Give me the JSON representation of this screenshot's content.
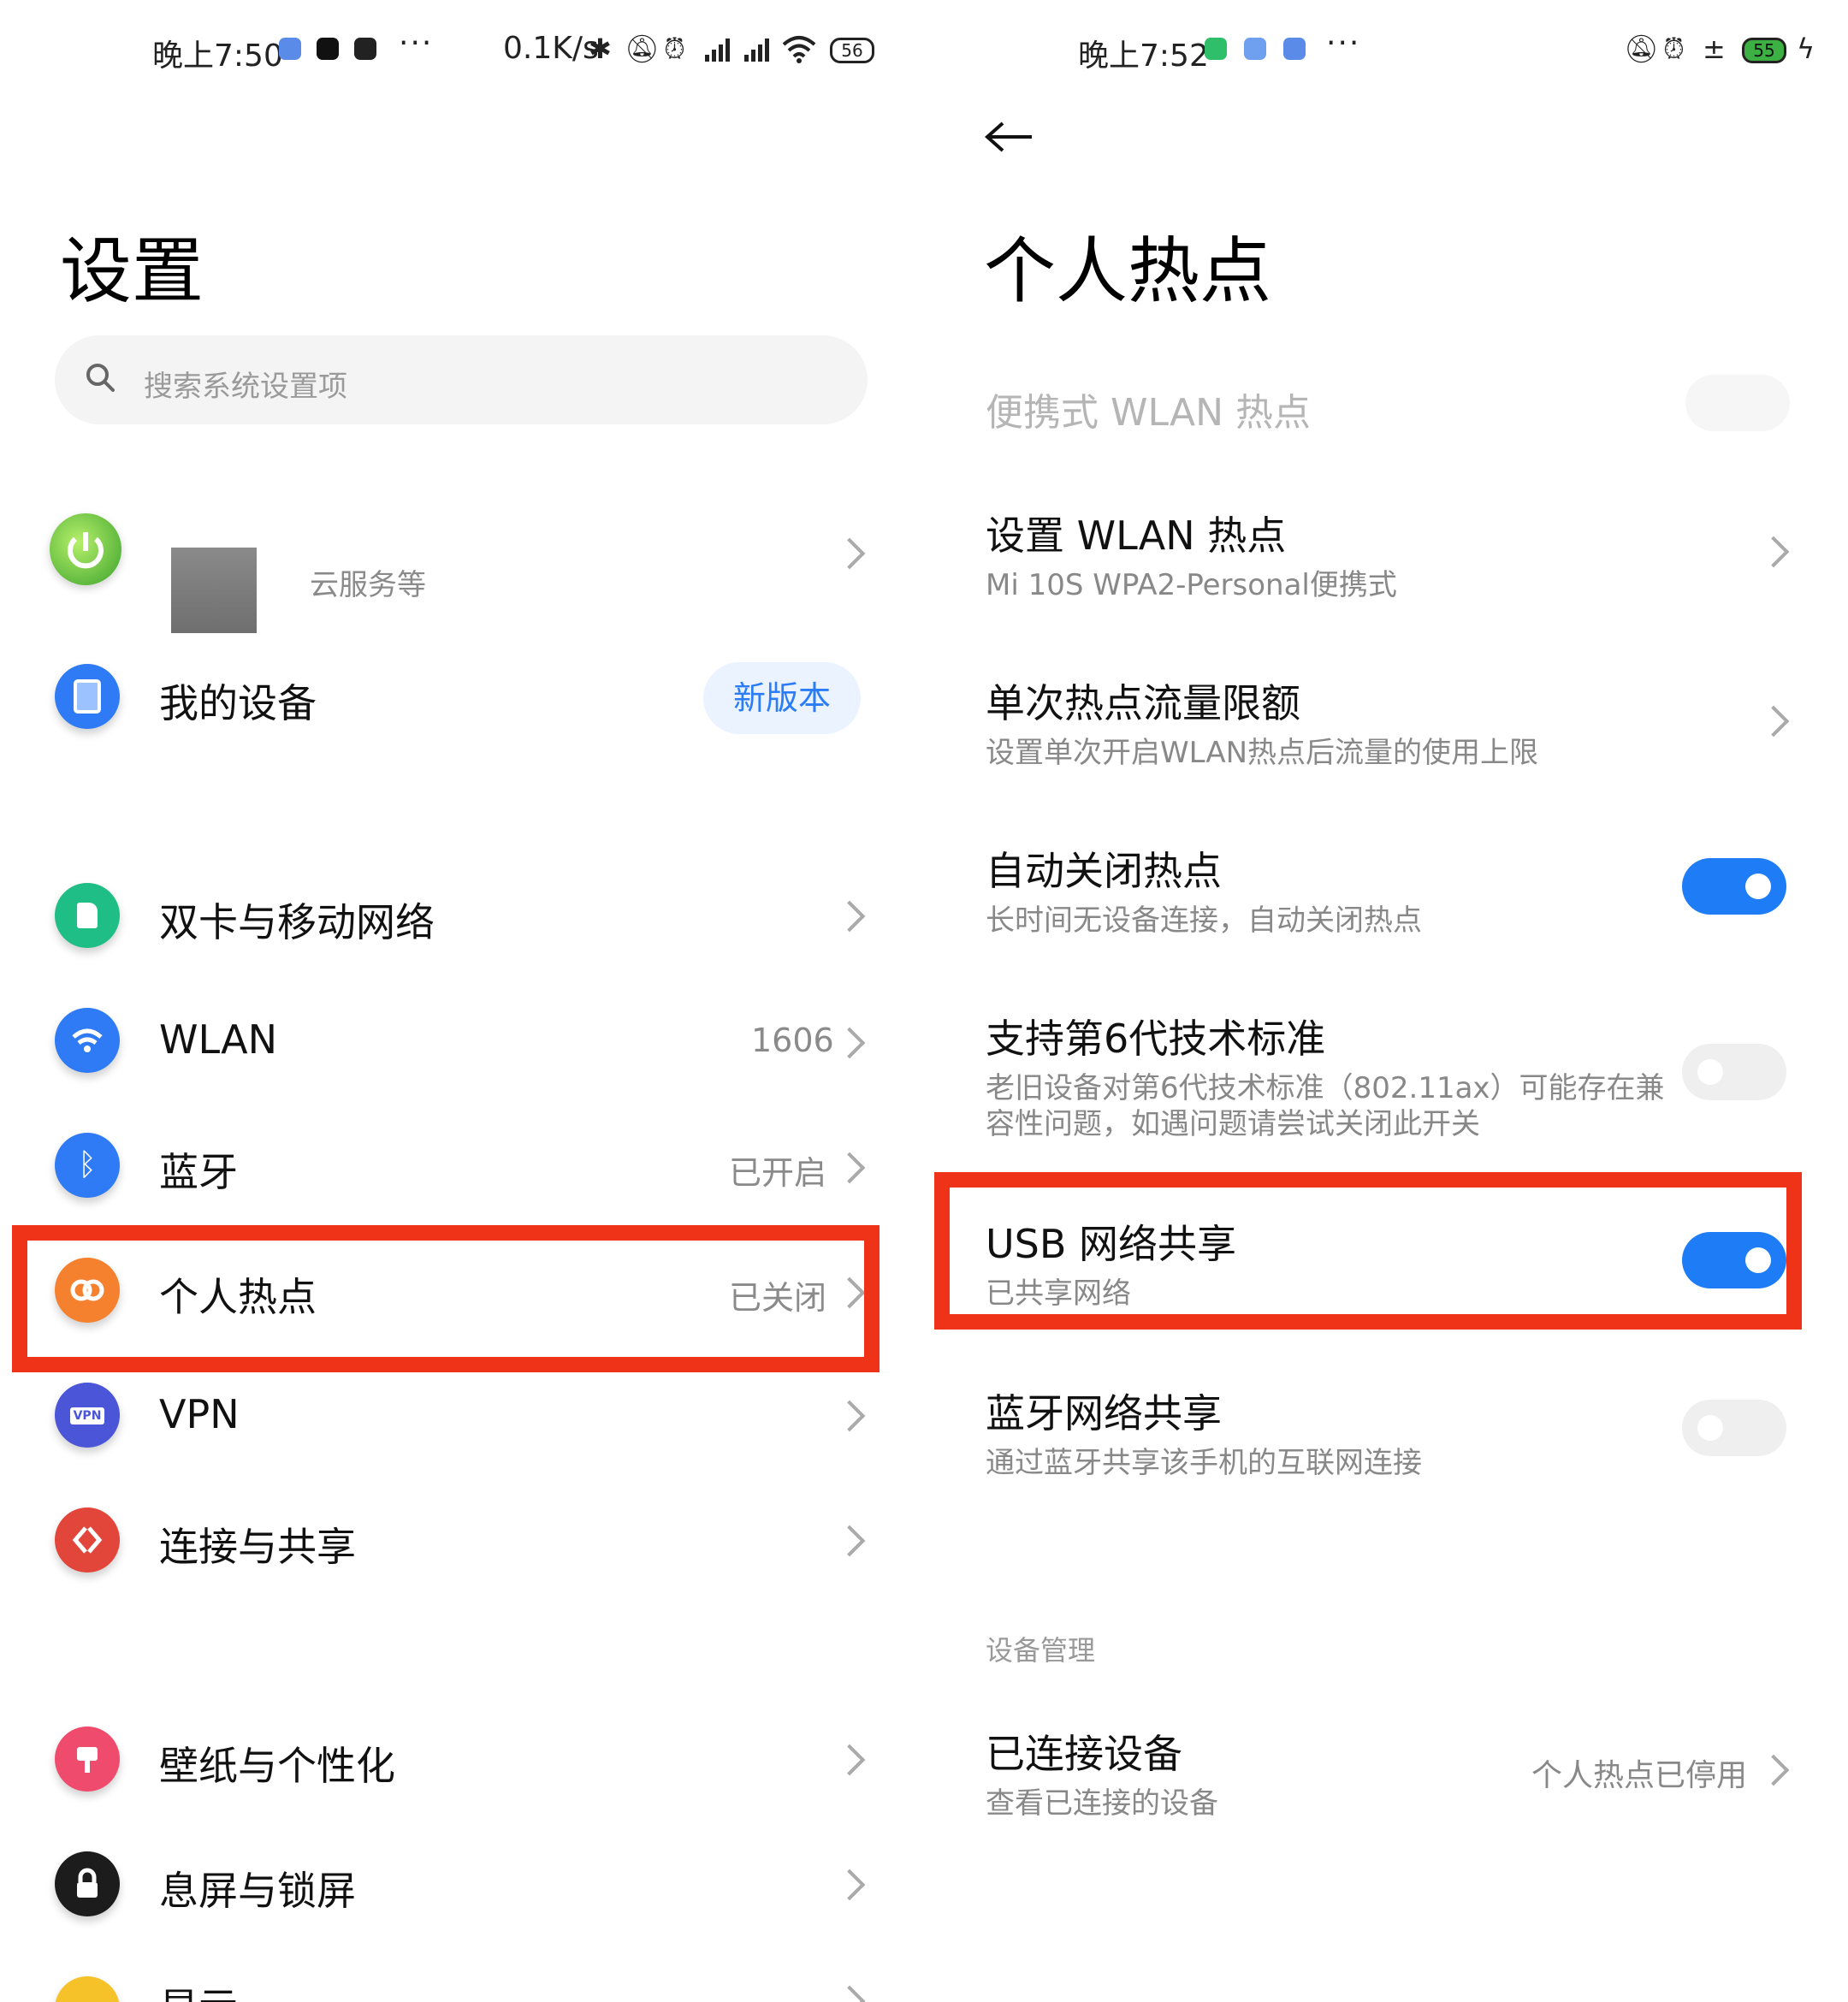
{
  "left": {
    "status_bar": {
      "time": "晚上7:50",
      "more": "···",
      "net_speed": "0.1K/s",
      "battery": "56"
    },
    "page_title": "设置",
    "search": {
      "placeholder": "搜索系统设置项"
    },
    "account": {
      "subtitle": "云服务等"
    },
    "my_device": {
      "label": "我的设备",
      "badge": "新版本"
    },
    "items": [
      {
        "label": "双卡与移动网络",
        "value": ""
      },
      {
        "label": "WLAN",
        "value": "1606"
      },
      {
        "label": "蓝牙",
        "value": "已开启"
      },
      {
        "label": "个人热点",
        "value": "已关闭"
      },
      {
        "label": "VPN",
        "value": ""
      },
      {
        "label": "连接与共享",
        "value": ""
      },
      {
        "label": "壁纸与个性化",
        "value": ""
      },
      {
        "label": "息屏与锁屏",
        "value": ""
      },
      {
        "label": "显示",
        "value": ""
      }
    ],
    "vpn_icon_text": "VPN"
  },
  "right": {
    "status_bar": {
      "time": "晚上7:52",
      "more": "···",
      "battery": "55"
    },
    "page_title": "个人热点",
    "portable_wlan": {
      "label": "便携式 WLAN 热点",
      "on": false,
      "disabled": true
    },
    "setup_wlan": {
      "title": "设置 WLAN 热点",
      "subtitle": "Mi 10S WPA2-Personal便携式"
    },
    "data_limit": {
      "title": "单次热点流量限额",
      "subtitle": "设置单次开启WLAN热点后流量的使用上限"
    },
    "auto_off": {
      "title": "自动关闭热点",
      "subtitle": "长时间无设备连接，自动关闭热点",
      "on": true
    },
    "wifi6": {
      "title": "支持第6代技术标准",
      "subtitle_line1": "老旧设备对第6代技术标准（802.11ax）可能存在兼",
      "subtitle_line2": "容性问题，如遇问题请尝试关闭此开关",
      "on": false
    },
    "usb_tether": {
      "title": "USB 网络共享",
      "subtitle": "已共享网络",
      "on": true
    },
    "bt_tether": {
      "title": "蓝牙网络共享",
      "subtitle": "通过蓝牙共享该手机的互联网连接",
      "on": false
    },
    "section_header": "设备管理",
    "connected": {
      "title": "已连接设备",
      "subtitle": "查看已连接的设备",
      "value": "个人热点已停用"
    }
  },
  "colors": {
    "accent_blue": "#1e7cf6",
    "highlight_red": "#ee3318"
  }
}
